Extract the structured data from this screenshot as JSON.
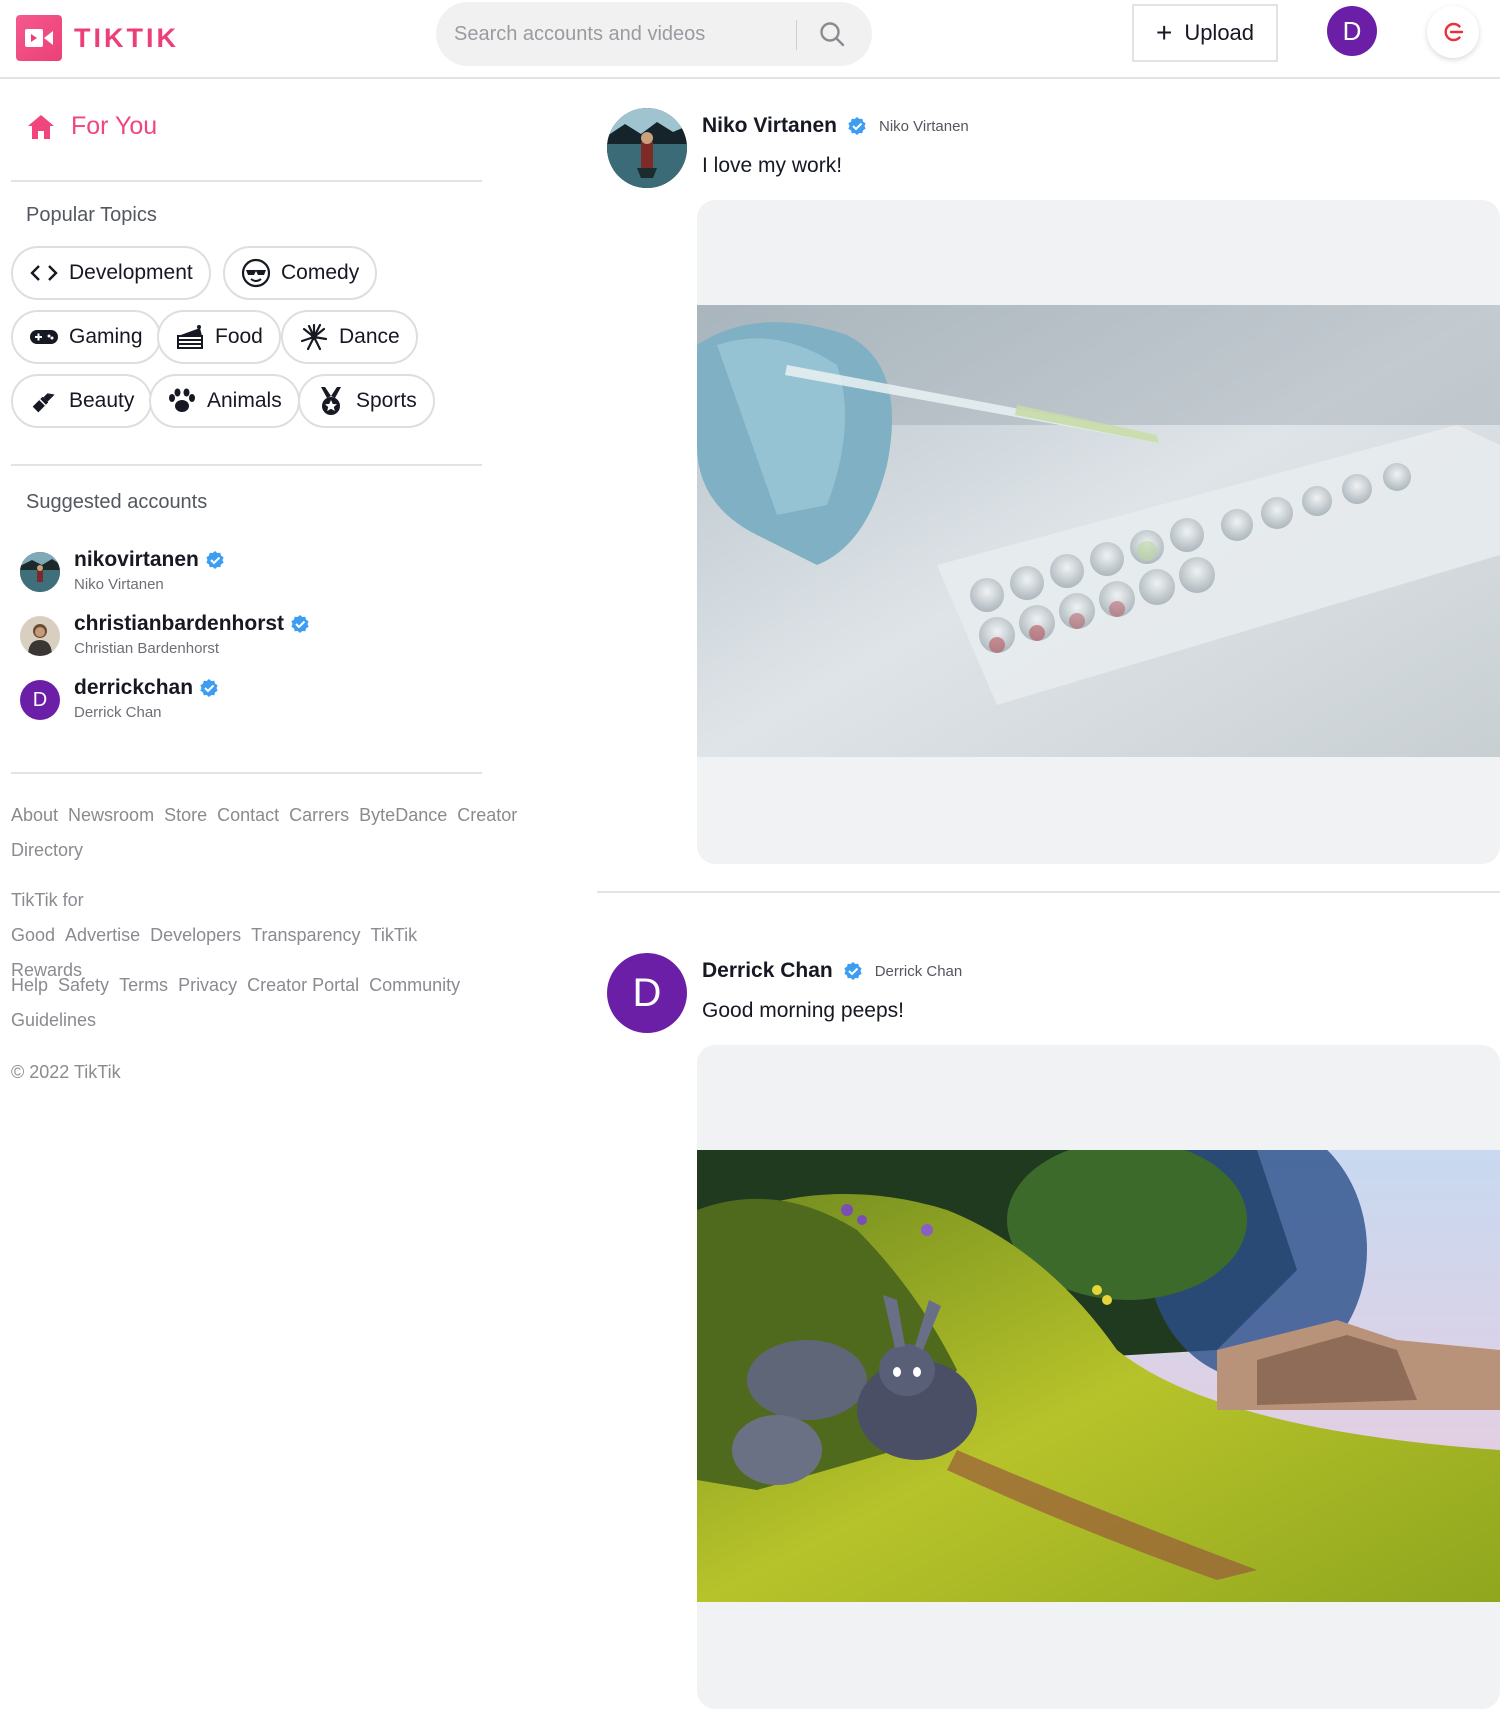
{
  "header": {
    "logo_text": "TIKTIK",
    "search_placeholder": "Search accounts and videos",
    "upload_label": "Upload",
    "user_initial": "D"
  },
  "sidebar": {
    "for_you": "For You",
    "topics_title": "Popular Topics",
    "topics": [
      {
        "label": "Development",
        "icon": "code-icon"
      },
      {
        "label": "Comedy",
        "icon": "sunglasses-face-icon"
      },
      {
        "label": "Gaming",
        "icon": "gamepad-icon"
      },
      {
        "label": "Food",
        "icon": "cake-icon"
      },
      {
        "label": "Dance",
        "icon": "dance-icon"
      },
      {
        "label": "Beauty",
        "icon": "lipstick-icon"
      },
      {
        "label": "Animals",
        "icon": "paw-icon"
      },
      {
        "label": "Sports",
        "icon": "medal-icon"
      }
    ],
    "suggested_title": "Suggested accounts",
    "accounts": [
      {
        "username": "nikovirtanen",
        "name": "Niko Virtanen"
      },
      {
        "username": "christianbardenhorst",
        "name": "Christian Bardenhorst"
      },
      {
        "username": "derrickchan",
        "name": "Derrick Chan",
        "initial": "D"
      }
    ],
    "footer": {
      "line1": [
        "About",
        "Newsroom",
        "Store",
        "Contact",
        "Carrers",
        "ByteDance",
        "Creator Directory"
      ],
      "line2": [
        "TikTik for Good",
        "Advertise",
        "Developers",
        "Transparency",
        "TikTik Rewards"
      ],
      "line3": [
        "Help",
        "Safety",
        "Terms",
        "Privacy",
        "Creator Portal",
        "Community Guidelines"
      ],
      "copyright": "© 2022 TikTik"
    }
  },
  "posts": [
    {
      "name": "Niko Virtanen",
      "handle": "Niko Virtanen",
      "caption": "I love my work!"
    },
    {
      "name": "Derrick Chan",
      "handle": "Derrick Chan",
      "caption": "Good morning peeps!",
      "initial": "D"
    }
  ],
  "colors": {
    "brand": "#ec3f78",
    "avatar_purple": "#6b1fa6",
    "verified_blue": "#3d9df2"
  }
}
